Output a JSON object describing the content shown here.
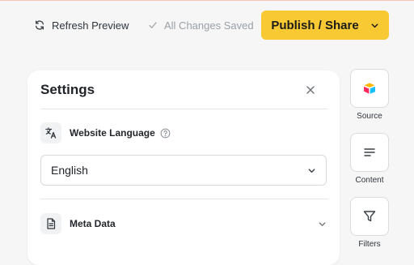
{
  "toolbar": {
    "refresh_label": "Refresh Preview",
    "saved_status": "All Changes Saved",
    "publish_label": "Publish / Share"
  },
  "settings": {
    "title": "Settings",
    "language": {
      "label": "Website Language",
      "selected": "English"
    },
    "meta_data": {
      "label": "Meta Data"
    }
  },
  "rail": {
    "items": [
      {
        "label": "Source",
        "icon": "airtable-logo-icon"
      },
      {
        "label": "Content",
        "icon": "lines-icon"
      },
      {
        "label": "Filters",
        "icon": "funnel-icon"
      }
    ]
  },
  "colors": {
    "publish_bg": "#f8c932",
    "page_bg": "#f6f6f6",
    "muted_text": "#9aa0a6"
  }
}
